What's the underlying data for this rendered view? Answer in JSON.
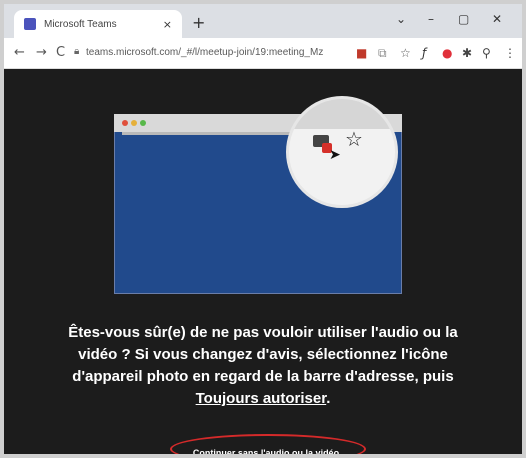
{
  "browser": {
    "tab_title": "Microsoft Teams",
    "tab_close": "×",
    "new_tab": "+",
    "url": "teams.microsoft.com/_#/l/meetup-join/19:meeting_Mz",
    "window": {
      "minimize": "–",
      "maximize": "▢",
      "close": "✕",
      "dropdown": "⌄"
    }
  },
  "message": {
    "line1": "Êtes-vous sûr(e) de ne pas vouloir utiliser l'audio ou la",
    "line2": "vidéo ? Si vous changez d'avis, sélectionnez l'icône",
    "line3": "d'appareil photo en regard de la barre d'adresse, puis",
    "link": "Toujours autoriser",
    "suffix": "."
  },
  "continue_button": {
    "label": "Continuer sans l'audio ou la vidéo"
  },
  "colors": {
    "brand": "#4b53bc",
    "illustration_blue": "#214a8c",
    "highlight_red": "#d52a2a"
  }
}
